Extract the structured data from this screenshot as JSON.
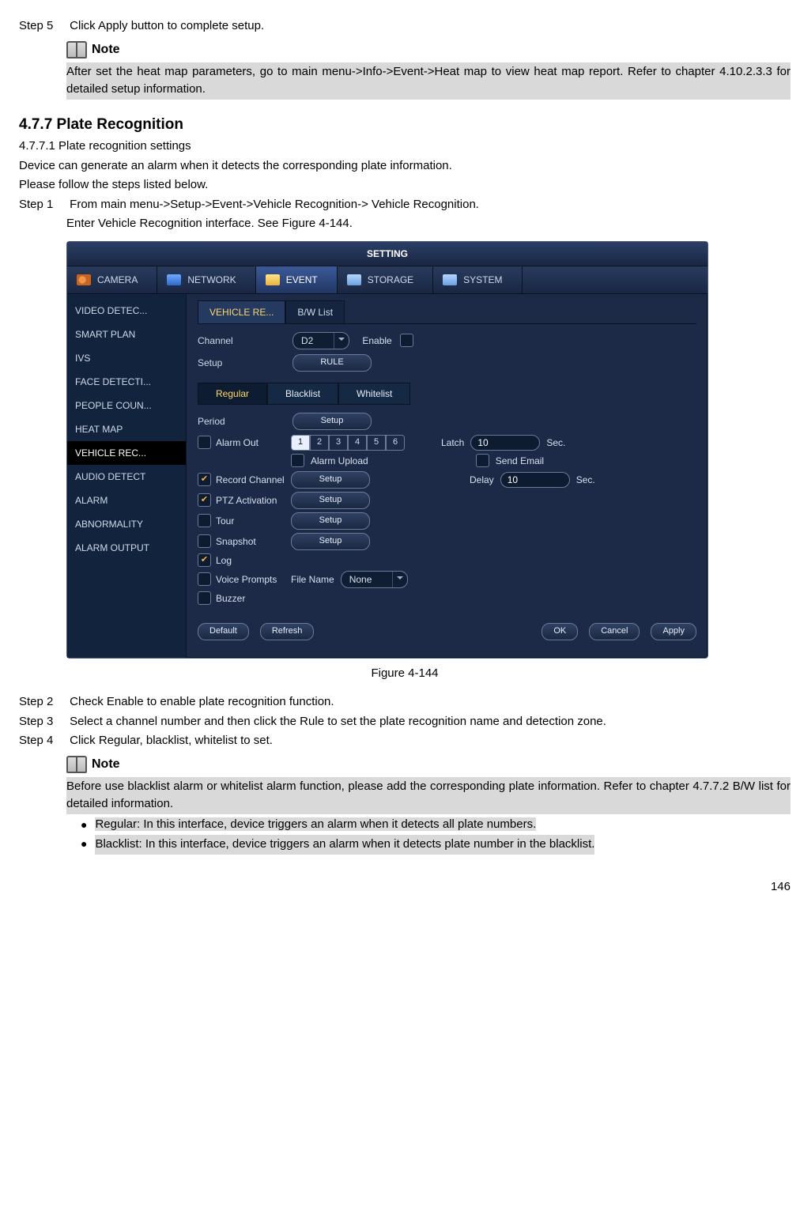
{
  "step5": {
    "num": "Step 5",
    "text": "Click Apply button to complete setup.",
    "note_label": "Note",
    "note_text": "After set the heat map parameters, go to main menu->Info->Event->Heat map to view heat map report. Refer to chapter 4.10.2.3.3 for detailed setup information."
  },
  "sec477": {
    "heading": "4.7.7 Plate Recognition",
    "sub": "4.7.7.1 Plate recognition settings",
    "intro1": "Device can generate an alarm when it detects the corresponding plate information.",
    "intro2": "Please follow the steps listed below.",
    "step1_num": "Step 1",
    "step1_a": "From main menu->Setup->Event->Vehicle Recognition-> Vehicle Recognition.",
    "step1_b": "Enter Vehicle Recognition interface. See Figure 4-144."
  },
  "figcap": "Figure 4-144",
  "steps_after": {
    "s2n": "Step 2",
    "s2t": "Check Enable to enable plate recognition function.",
    "s3n": "Step 3",
    "s3t": "Select a channel number and then click the Rule to set the plate recognition name and detection zone.",
    "s4n": "Step 4",
    "s4t": "Click Regular, blacklist, whitelist to set."
  },
  "note2": {
    "label": "Note",
    "text": "Before use blacklist alarm or whitelist alarm function, please add the corresponding plate information. Refer to chapter 4.7.7.2 B/W list for detailed information.",
    "b1": "Regular: In this interface, device triggers an alarm when it detects all plate numbers.",
    "b2": "Blacklist: In this interface, device triggers an alarm when it detects plate number in the blacklist."
  },
  "page_number": "146",
  "ui": {
    "title": "SETTING",
    "tabs": {
      "camera": "CAMERA",
      "network": "NETWORK",
      "event": "EVENT",
      "storage": "STORAGE",
      "system": "SYSTEM"
    },
    "side": [
      "VIDEO DETEC...",
      "SMART PLAN",
      "IVS",
      "FACE DETECTI...",
      "PEOPLE COUN...",
      "HEAT MAP",
      "VEHICLE REC...",
      "AUDIO DETECT",
      "ALARM",
      "ABNORMALITY",
      "ALARM OUTPUT"
    ],
    "ctabs": {
      "vehicle": "VEHICLE RE...",
      "bw": "B/W List"
    },
    "fields": {
      "channel": "Channel",
      "channel_val": "D2",
      "enable": "Enable",
      "setup": "Setup",
      "rule": "RULE",
      "subtabs": {
        "reg": "Regular",
        "bl": "Blacklist",
        "wl": "Whitelist"
      },
      "period": "Period",
      "setup_btn": "Setup",
      "alarm_out": "Alarm Out",
      "segs": [
        "1",
        "2",
        "3",
        "4",
        "5",
        "6"
      ],
      "latch": "Latch",
      "latch_val": "10",
      "sec": "Sec.",
      "alarm_upload": "Alarm Upload",
      "send_email": "Send Email",
      "record_channel": "Record Channel",
      "delay": "Delay",
      "delay_val": "10",
      "ptz": "PTZ Activation",
      "tour": "Tour",
      "snapshot": "Snapshot",
      "log": "Log",
      "voice": "Voice Prompts",
      "filename": "File Name",
      "filename_val": "None",
      "buzzer": "Buzzer"
    },
    "footer": {
      "default": "Default",
      "refresh": "Refresh",
      "ok": "OK",
      "cancel": "Cancel",
      "apply": "Apply"
    }
  }
}
